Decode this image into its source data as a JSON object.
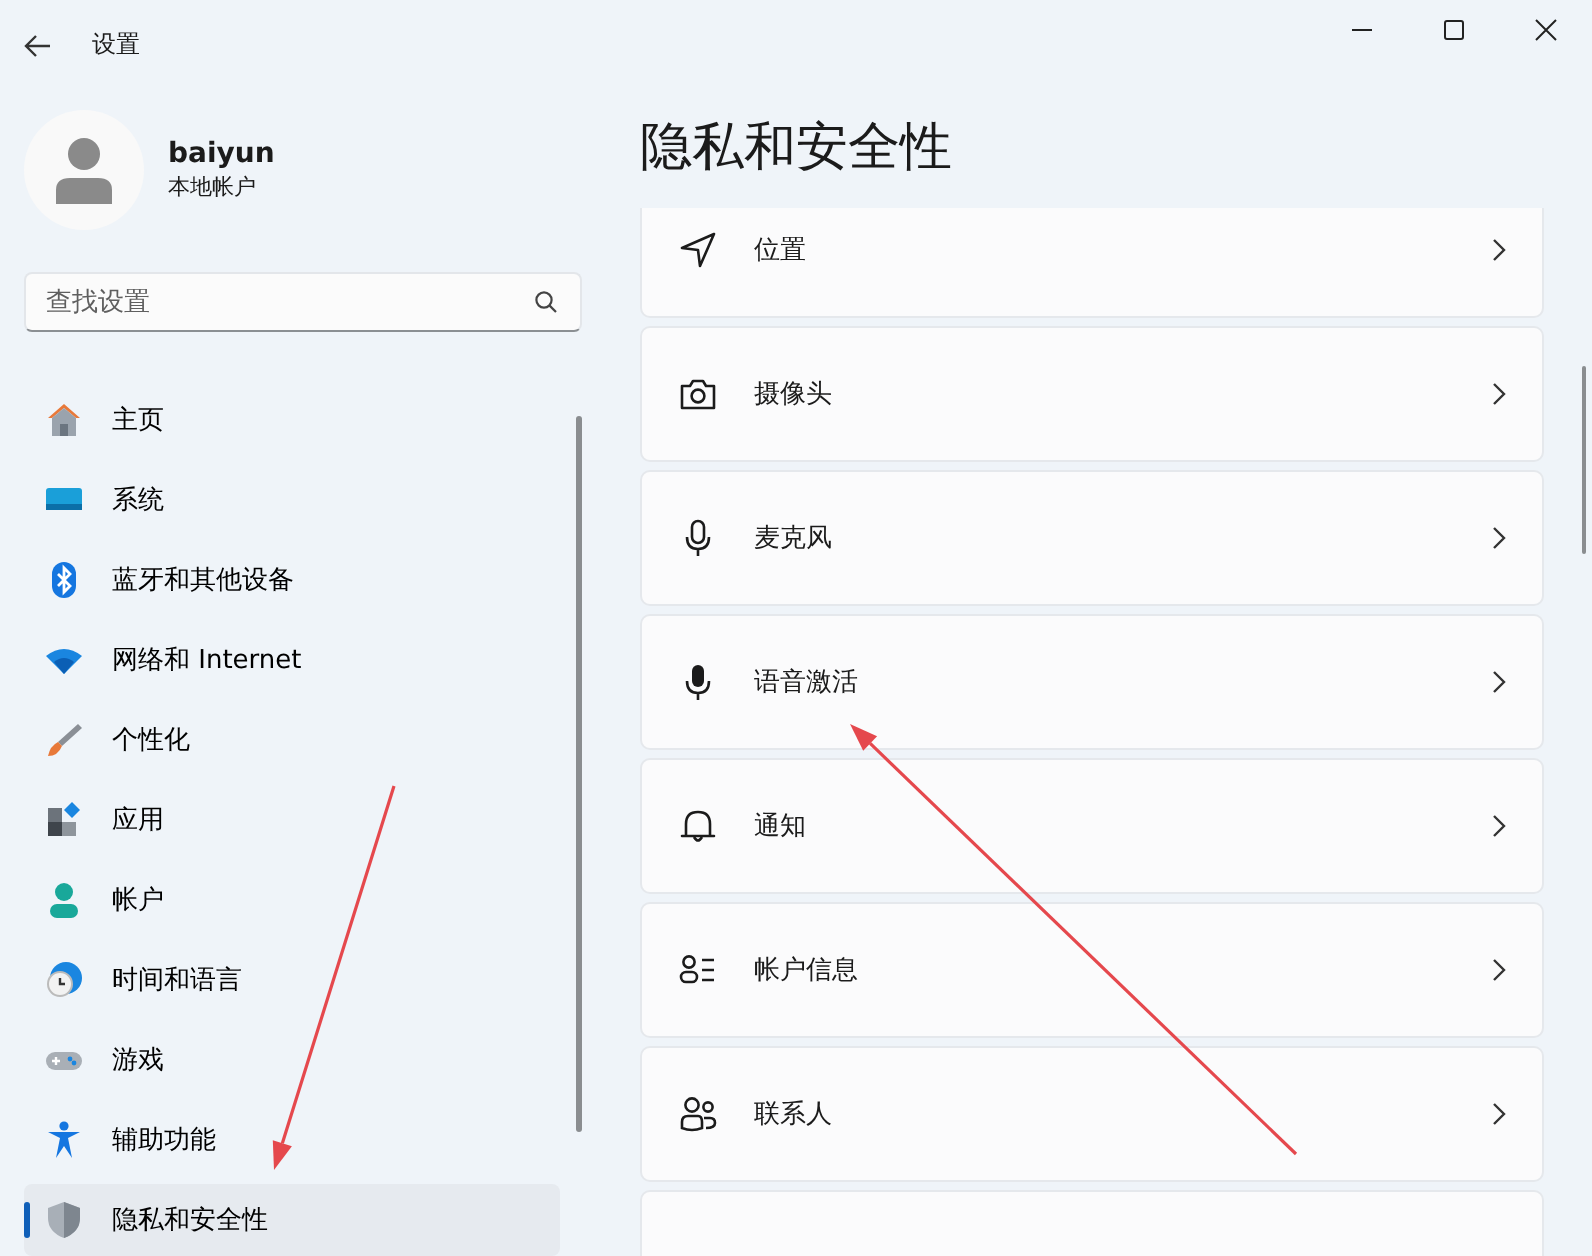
{
  "window": {
    "title": "设置"
  },
  "profile": {
    "name": "baiyun",
    "account_type": "本地帐户"
  },
  "search": {
    "placeholder": "查找设置"
  },
  "nav": [
    {
      "label": "主页",
      "selected": false
    },
    {
      "label": "系统",
      "selected": false
    },
    {
      "label": "蓝牙和其他设备",
      "selected": false
    },
    {
      "label": "网络和 Internet",
      "selected": false
    },
    {
      "label": "个性化",
      "selected": false
    },
    {
      "label": "应用",
      "selected": false
    },
    {
      "label": "帐户",
      "selected": false
    },
    {
      "label": "时间和语言",
      "selected": false
    },
    {
      "label": "游戏",
      "selected": false
    },
    {
      "label": "辅助功能",
      "selected": false
    },
    {
      "label": "隐私和安全性",
      "selected": true
    }
  ],
  "page": {
    "title": "隐私和安全性",
    "items": [
      {
        "kind": "link",
        "label": "位置"
      },
      {
        "kind": "link",
        "label": "摄像头"
      },
      {
        "kind": "link",
        "label": "麦克风"
      },
      {
        "kind": "link",
        "label": "语音激活"
      },
      {
        "kind": "link",
        "label": "通知"
      },
      {
        "kind": "link",
        "label": "帐户信息"
      },
      {
        "kind": "link",
        "label": "联系人"
      },
      {
        "kind": "partial"
      }
    ]
  },
  "annotations": [
    {
      "kind": "arrow"
    },
    {
      "kind": "arrow"
    }
  ]
}
